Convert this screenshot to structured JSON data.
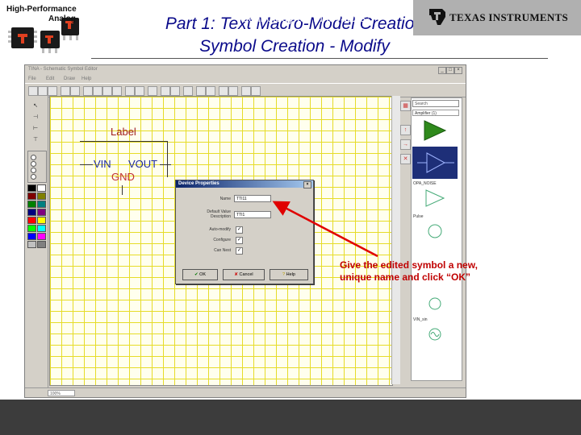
{
  "slide": {
    "title_line1": "Part 1: Text Macro-Model Creation",
    "title_line2": "Symbol Creation - Modify",
    "logo_line1": "High-Performance",
    "logo_line2": "Analog",
    "callout_text": "Give the edited symbol a new, unique name and click “OK”",
    "footer_tagline": "Technology for Innovators™",
    "footer_brand": "TEXAS INSTRUMENTS"
  },
  "app": {
    "window_title": "TINA - Schematic Symbol Editor",
    "menu": [
      "File",
      "Edit",
      "Draw",
      "Help"
    ],
    "canvas_symbol": {
      "label": "Label",
      "pin_vin": "VIN",
      "pin_vout": "VOUT",
      "pin_gnd": "GND"
    },
    "right_panel": {
      "search_placeholder": "Search",
      "library_selected": "Amplifier (1)",
      "items": [
        "OPA_NOISE",
        "Pulse",
        "VIN_sin"
      ]
    },
    "status_zoom": "100%"
  },
  "dialog": {
    "title": "Device Properties",
    "name_label": "Name",
    "name_value": "TTI11",
    "description_label": "Default Value Description",
    "description_value": "TTI1",
    "checkbox1_label": "Auto-modify",
    "checkbox2_label": "Configure",
    "checkbox3_label": "Can Nest",
    "ok_label": "OK",
    "cancel_label": "Cancel",
    "help_label": "Help"
  },
  "colors": {
    "title": "#0a0a8a",
    "callout": "#c00000",
    "grid_line": "#e6dc28",
    "footer_bg": "#3c3c3c"
  }
}
